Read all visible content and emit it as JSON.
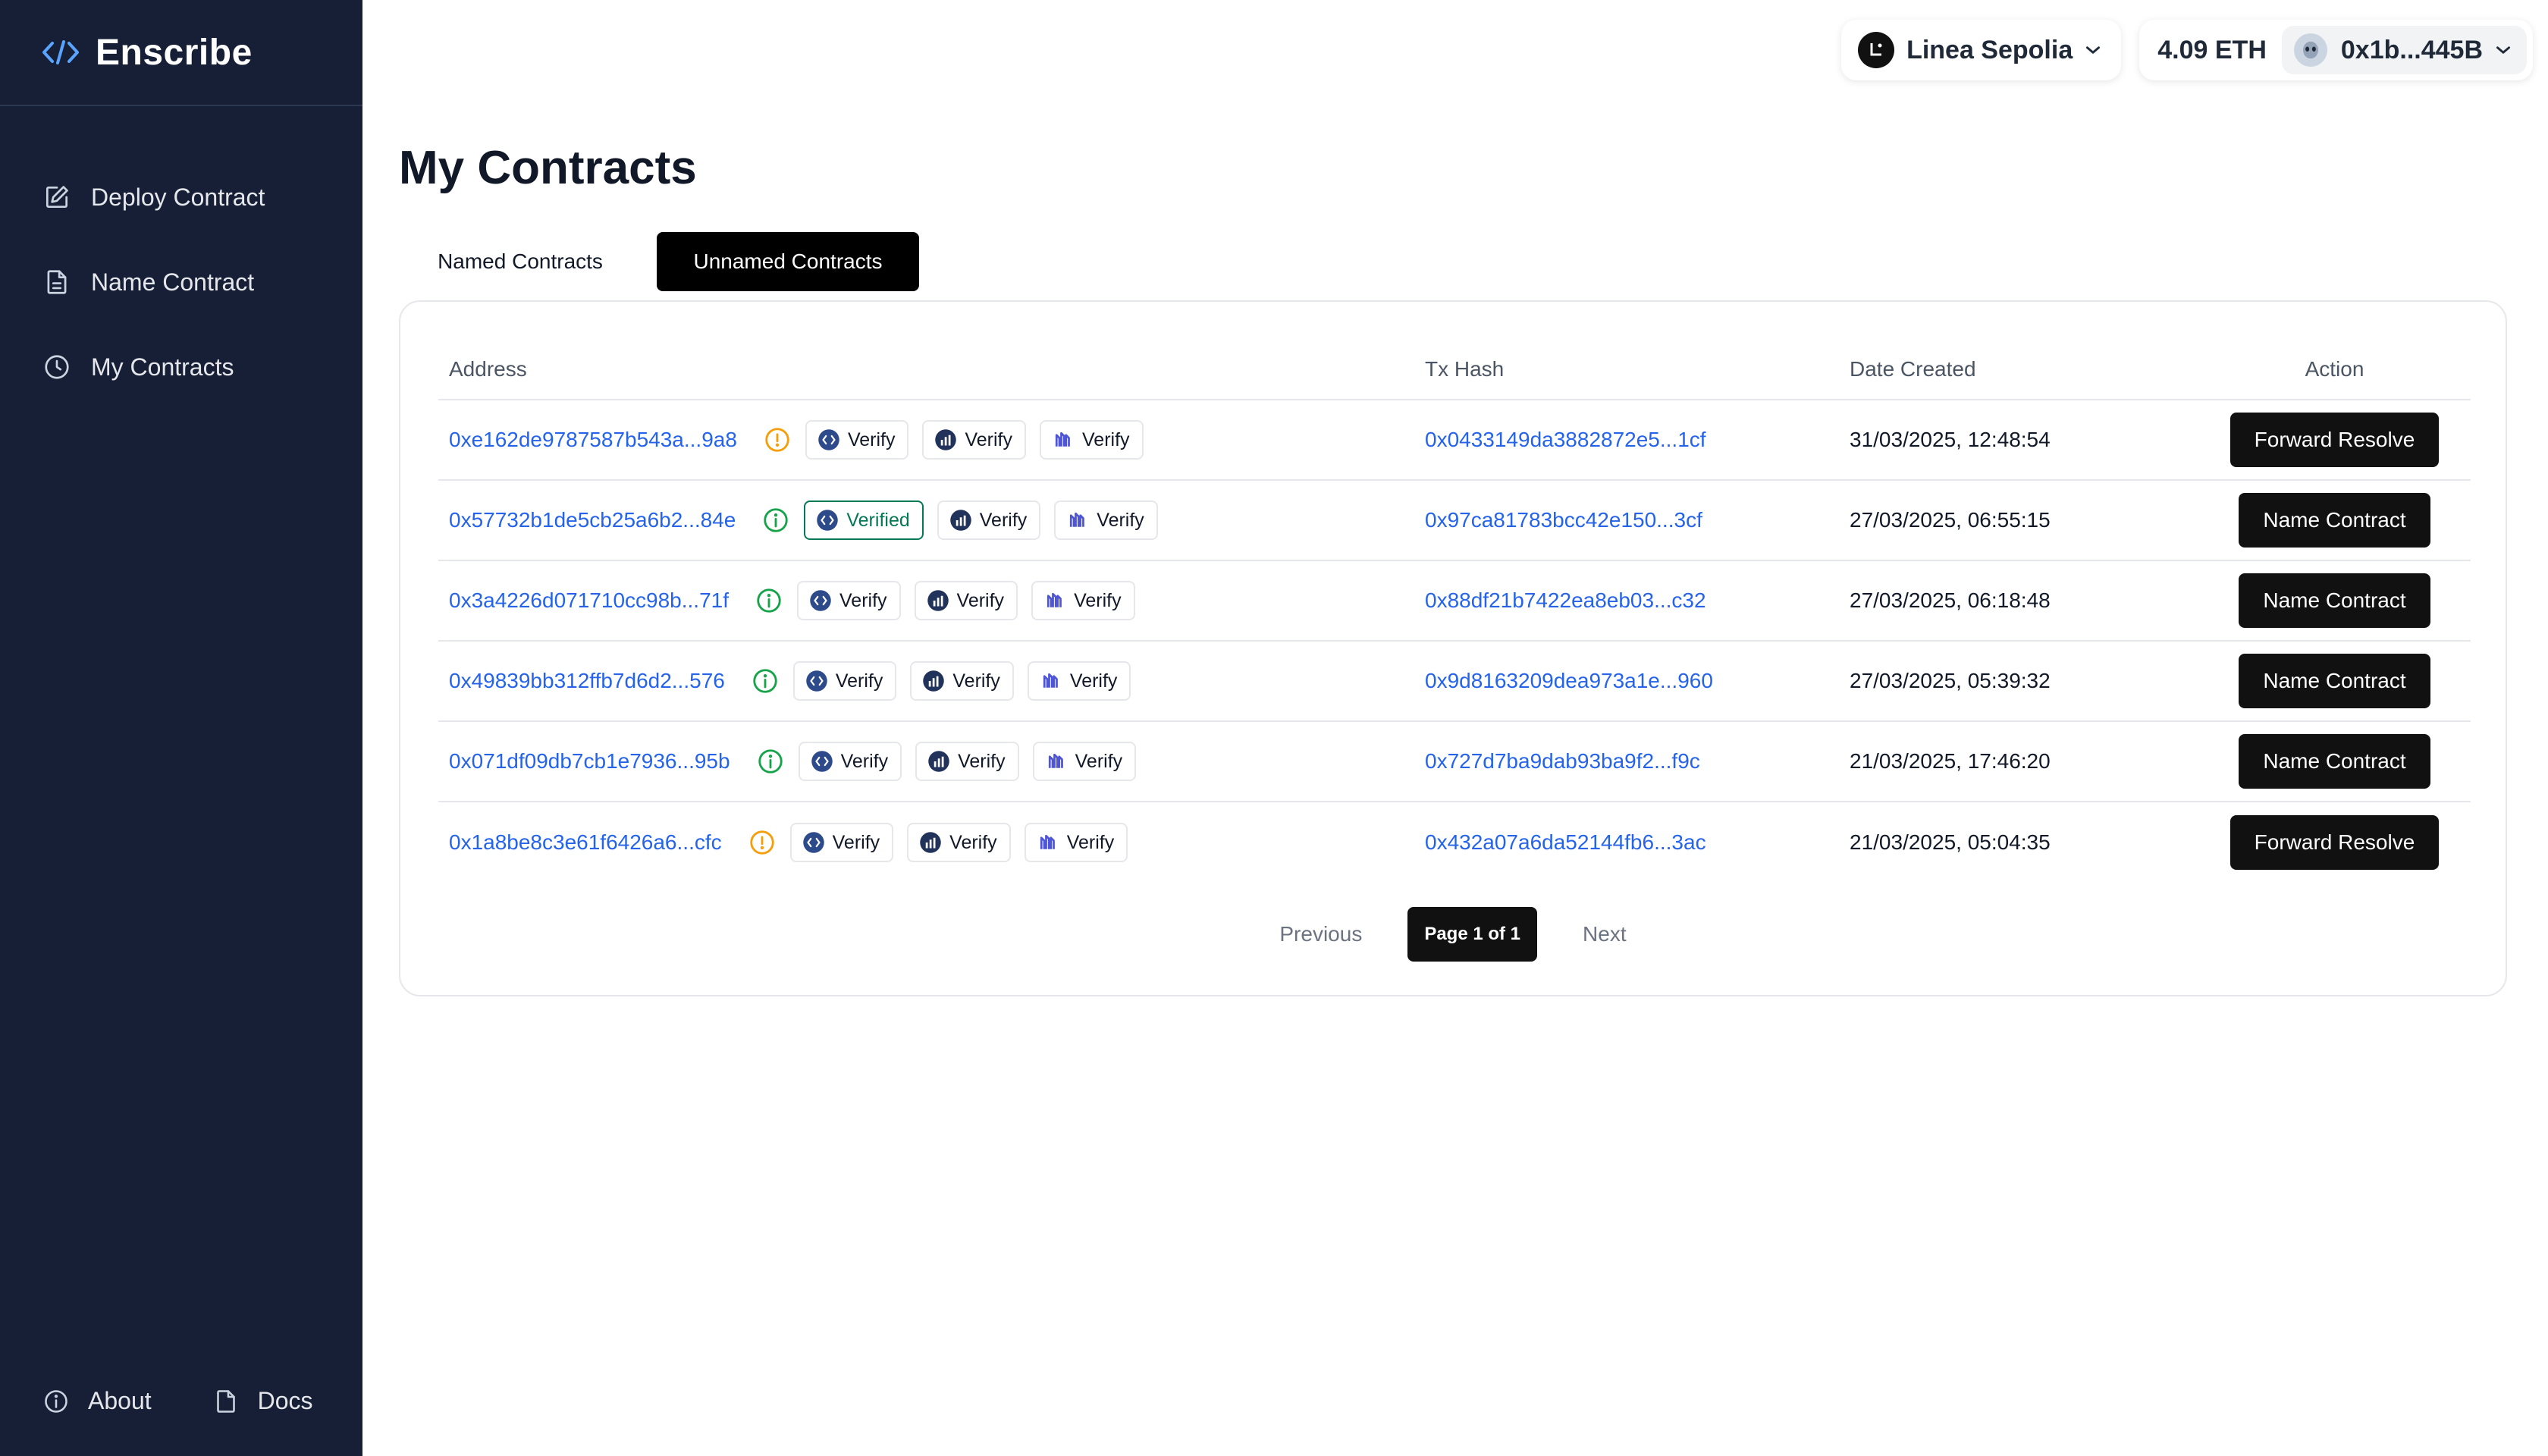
{
  "brand": {
    "name": "Enscribe",
    "icon": "code-brackets-icon"
  },
  "sidebar": {
    "items": [
      {
        "label": "Deploy Contract",
        "icon": "pencil-square-icon"
      },
      {
        "label": "Name Contract",
        "icon": "document-icon"
      },
      {
        "label": "My Contracts",
        "icon": "clock-icon"
      }
    ],
    "footer": [
      {
        "label": "About",
        "icon": "info-icon"
      },
      {
        "label": "Docs",
        "icon": "document-icon"
      }
    ]
  },
  "header": {
    "network": "Linea Sepolia",
    "balance": "4.09 ETH",
    "account": "0x1b...445B"
  },
  "main": {
    "title": "My Contracts",
    "tabs": [
      {
        "label": "Named Contracts",
        "active": false
      },
      {
        "label": "Unnamed Contracts",
        "active": true
      }
    ],
    "table": {
      "headers": {
        "address": "Address",
        "tx": "Tx Hash",
        "date": "Date Created",
        "action": "Action"
      },
      "verify_label": "Verify",
      "verified_label": "Verified",
      "rows": [
        {
          "address": "0xe162de9787587b543a...9a8",
          "status": "warning",
          "first_verified": false,
          "tx": "0x0433149da3882872e5...1cf",
          "date": "31/03/2025, 12:48:54",
          "action": "Forward Resolve"
        },
        {
          "address": "0x57732b1de5cb25a6b2...84e",
          "status": "ok",
          "first_verified": true,
          "tx": "0x97ca81783bcc42e150...3cf",
          "date": "27/03/2025, 06:55:15",
          "action": "Name Contract"
        },
        {
          "address": "0x3a4226d071710cc98b...71f",
          "status": "ok",
          "first_verified": false,
          "tx": "0x88df21b7422ea8eb03...c32",
          "date": "27/03/2025, 06:18:48",
          "action": "Name Contract"
        },
        {
          "address": "0x49839bb312ffb7d6d2...576",
          "status": "ok",
          "first_verified": false,
          "tx": "0x9d8163209dea973a1e...960",
          "date": "27/03/2025, 05:39:32",
          "action": "Name Contract"
        },
        {
          "address": "0x071df09db7cb1e7936...95b",
          "status": "ok",
          "first_verified": false,
          "tx": "0x727d7ba9dab93ba9f2...f9c",
          "date": "21/03/2025, 17:46:20",
          "action": "Name Contract"
        },
        {
          "address": "0x1a8be8c3e61f6426a6...cfc",
          "status": "warning",
          "first_verified": false,
          "tx": "0x432a07a6da52144fb6...3ac",
          "date": "21/03/2025, 05:04:35",
          "action": "Forward Resolve"
        }
      ]
    },
    "pagination": {
      "previous": "Previous",
      "current": "Page 1 of 1",
      "next": "Next"
    }
  },
  "colors": {
    "sidebar_bg": "#161f36",
    "link": "#2563eb",
    "warning": "#f59e0b",
    "ok": "#16a34a",
    "verified": "#047857"
  }
}
